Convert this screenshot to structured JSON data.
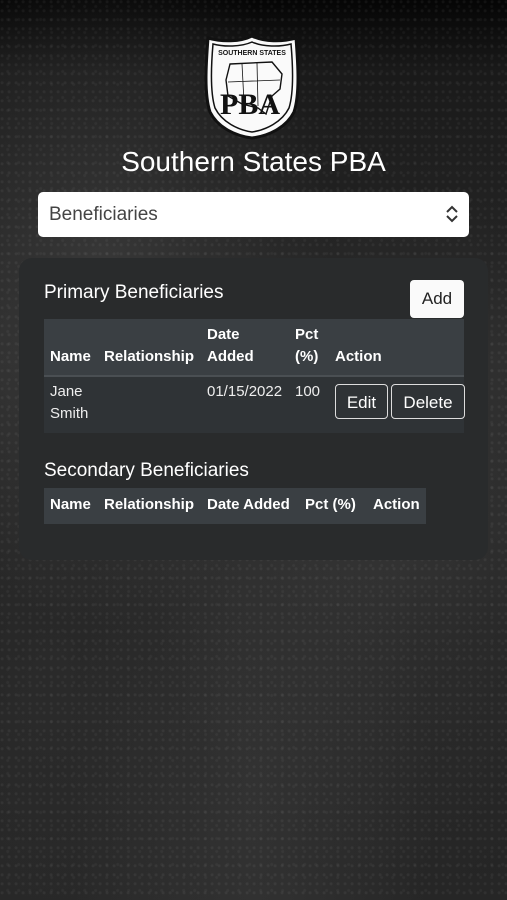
{
  "logo": {
    "top_text": "SOUTHERN STATES",
    "letters": "PBA"
  },
  "app_title": "Southern States PBA",
  "section_select": {
    "selected": "Beneficiaries"
  },
  "primary": {
    "title": "Primary Beneficiaries",
    "add_label": "Add",
    "headers": {
      "name": "Name",
      "relationship": "Relationship",
      "date_line1": "Date",
      "date_line2": "Added",
      "pct_line1": "Pct",
      "pct_line2": "(%)",
      "action": "Action"
    },
    "rows": [
      {
        "name_line1": "Jane",
        "name_line2": "Smith",
        "relationship": "",
        "date_added": "01/15/2022",
        "pct": "100",
        "edit_label": "Edit",
        "delete_label": "Delete"
      }
    ]
  },
  "secondary": {
    "title": "Secondary Beneficiaries",
    "headers": {
      "name": "Name",
      "relationship": "Relationship",
      "date_added": "Date Added",
      "pct": "Pct (%)",
      "action": "Action"
    }
  }
}
